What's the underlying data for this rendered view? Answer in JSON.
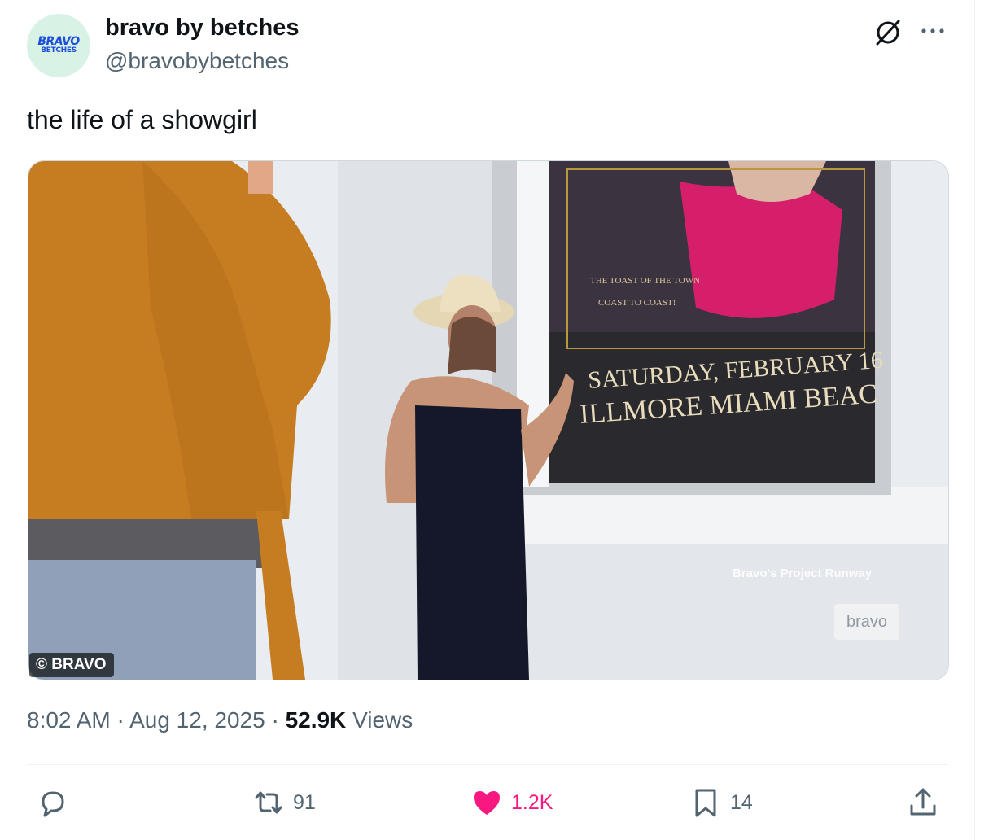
{
  "account": {
    "display_name": "bravo by betches",
    "handle": "@bravobybetches",
    "avatar_line1": "BRAVO",
    "avatar_line2": "BETCHES"
  },
  "post": {
    "text": "the life of a showgirl",
    "time": "8:02 AM",
    "date": "Aug 12, 2025",
    "views_count": "52.9K",
    "views_label": "Views"
  },
  "media": {
    "credit": "© BRAVO",
    "poster_tagline_1": "THE TOAST OF THE TOWN",
    "poster_tagline_2": "COAST TO COAST!",
    "poster_date": "SATURDAY, FEBRUARY 16",
    "poster_venue": "ILLMORE MIAMI BEAC",
    "watermark_line": "Bravo's Project Runway",
    "watermark_logo": "bravo"
  },
  "actions": {
    "replies_icon": "reply-icon",
    "retweets": "91",
    "likes": "1.2K",
    "bookmarks": "14"
  },
  "colors": {
    "like": "#f91880",
    "muted": "#536471",
    "text": "#0f1419",
    "avatar_bg": "#d8f3e6"
  }
}
